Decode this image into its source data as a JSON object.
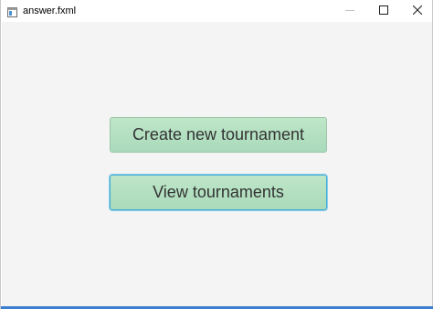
{
  "window": {
    "title": "answer.fxml"
  },
  "icons": {
    "app": "app-window-icon",
    "minimize": "minimize-icon",
    "maximize": "maximize-icon",
    "close": "close-icon"
  },
  "main": {
    "create_button_label": "Create new tournament",
    "view_button_label": "View tournaments"
  },
  "colors": {
    "button_fill": "#b5e0c2",
    "focus_ring": "#3fa8d8",
    "content_background": "#f4f4f4",
    "window_accent": "#3c7fcf"
  }
}
